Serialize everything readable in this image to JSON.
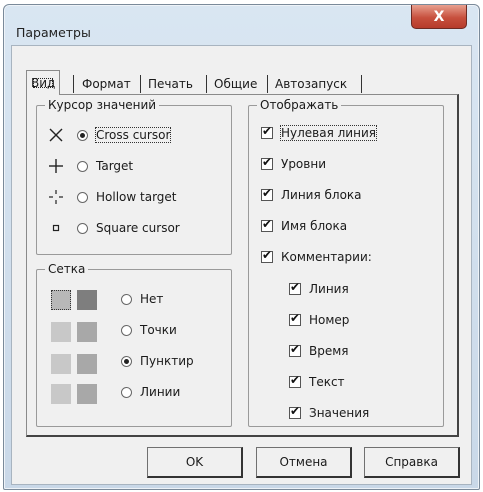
{
  "window": {
    "title": "Параметры",
    "close_label": "X"
  },
  "tabs": [
    {
      "label": "Вид"
    },
    {
      "label": "Формат"
    },
    {
      "label": "Печать"
    },
    {
      "label": "Общие"
    },
    {
      "label": "Автозапуск"
    }
  ],
  "cursor_group": {
    "title": "Курсор значений",
    "options": [
      {
        "label": "Cross cursor",
        "selected": true,
        "icon": "cross-icon"
      },
      {
        "label": "Target",
        "selected": false,
        "icon": "target-icon"
      },
      {
        "label": "Hollow target",
        "selected": false,
        "icon": "hollow-target-icon"
      },
      {
        "label": "Square cursor",
        "selected": false,
        "icon": "square-icon"
      }
    ]
  },
  "grid_group": {
    "title": "Сетка",
    "options": [
      {
        "label": "Нет",
        "selected": false
      },
      {
        "label": "Точки",
        "selected": false
      },
      {
        "label": "Пунктир",
        "selected": true
      },
      {
        "label": "Линии",
        "selected": false
      }
    ],
    "swatch_colors": [
      "#b8b8b8",
      "#7e7e7e",
      "#c8c8c8",
      "#a8a8a8"
    ]
  },
  "display_group": {
    "title": "Отображать",
    "items": [
      {
        "label": "Нулевая линия",
        "checked": true
      },
      {
        "label": "Уровни",
        "checked": true
      },
      {
        "label": "Линия блока",
        "checked": true
      },
      {
        "label": "Имя блока",
        "checked": true
      },
      {
        "label": "Комментарии:",
        "checked": true
      }
    ],
    "comment_items": [
      {
        "label": "Линия",
        "checked": true
      },
      {
        "label": "Номер",
        "checked": true
      },
      {
        "label": "Время",
        "checked": true
      },
      {
        "label": "Текст",
        "checked": true
      },
      {
        "label": "Значения",
        "checked": true
      }
    ]
  },
  "buttons": {
    "ok": "OK",
    "cancel": "Отмена",
    "help": "Справка"
  }
}
